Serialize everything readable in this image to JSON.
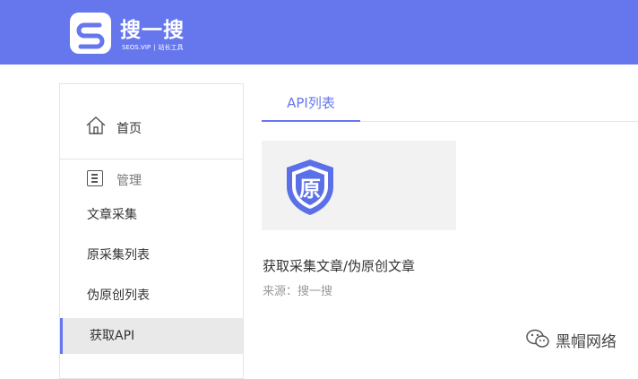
{
  "header": {
    "brand_title": "搜一搜",
    "brand_domain": "SEOS.VIP",
    "brand_divider": "|",
    "brand_tagline": "站长工具",
    "logo_icon": "s-logo-icon"
  },
  "sidebar": {
    "home_label": "首页",
    "home_icon": "house-icon",
    "manage_label": "管理",
    "manage_icon": "list-box-icon",
    "items": [
      {
        "label": "文章采集"
      },
      {
        "label": "原采集列表"
      },
      {
        "label": "伪原创列表"
      },
      {
        "label": "获取API",
        "active": true
      }
    ]
  },
  "main": {
    "tabs": [
      {
        "label": "API列表",
        "active": true
      }
    ],
    "card": {
      "badge_char": "原",
      "title": "获取采集文章/伪原创文章",
      "source": "来源：搜一搜"
    }
  },
  "watermark": {
    "text": "黑帽网络",
    "icon": "wechat-icon"
  },
  "colors": {
    "accent": "#6677ee",
    "active_bg": "#e9e9e9"
  }
}
